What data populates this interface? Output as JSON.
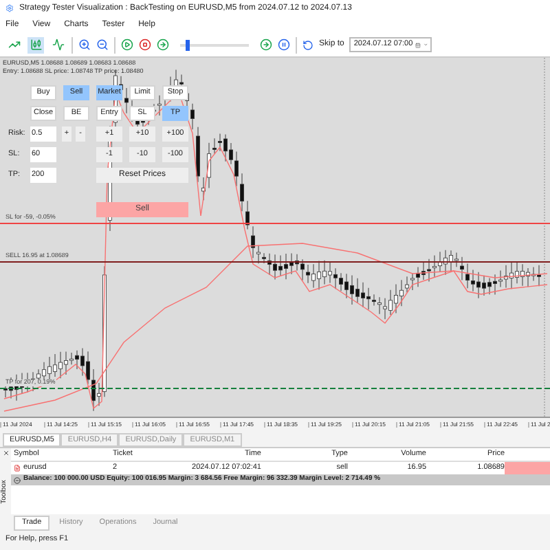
{
  "window": {
    "title": "Strategy Tester Visualization : BackTesting on EURUSD,M5 from 2024.07.12 to 2024.07.13"
  },
  "menu": [
    "File",
    "View",
    "Charts",
    "Tester",
    "Help"
  ],
  "toolbar": {
    "chart_modes": [
      {
        "kind": "bars",
        "selected": false
      },
      {
        "kind": "candles",
        "selected": true
      },
      {
        "kind": "line",
        "selected": false
      }
    ],
    "speed": {
      "level": 0.08
    },
    "skip_label": "Skip to",
    "skip_date": "2024.07.12 07:00"
  },
  "chart": {
    "info_lines": [
      "EURUSD,M5  1.08688 1.08689 1.08683 1.08688",
      "Entry: 1.08688  SL price: 1.08748  TP price: 1.08480"
    ],
    "levels": [
      {
        "kind": "sl",
        "label": "SL for -59, -0.05%"
      },
      {
        "kind": "entry",
        "label": "SELL 16.95 at 1.08689"
      },
      {
        "kind": "tp",
        "label": "TP for 207, 0.19%"
      }
    ],
    "panel": {
      "rows": [
        [
          {
            "label": "Buy",
            "selected": false
          },
          {
            "label": "Sell",
            "selected": true
          },
          {
            "label": "Market",
            "selected": true
          },
          {
            "label": "Limit",
            "selected": false
          },
          {
            "label": "Stop",
            "selected": false
          }
        ],
        [
          {
            "label": "Close",
            "selected": false
          },
          {
            "label": "BE",
            "selected": false
          },
          {
            "label": "Entry",
            "selected": false
          },
          {
            "label": "SL",
            "selected": false
          },
          {
            "label": "TP",
            "selected": true
          }
        ]
      ],
      "fields": [
        {
          "label": "Risk:",
          "value": "0.5",
          "small_buttons": [
            "+",
            "-"
          ],
          "steps": [
            "+1",
            "+10",
            "+100"
          ]
        },
        {
          "label": "SL:",
          "value": "60",
          "steps": [
            "-1",
            "-10",
            "-100"
          ]
        },
        {
          "label": "TP:",
          "value": "200"
        }
      ],
      "reset": "Reset Prices",
      "action": "Sell"
    },
    "time_labels": [
      "11 Jul 2024",
      "11 Jul 14:25",
      "11 Jul 15:15",
      "11 Jul 16:05",
      "11 Jul 16:55",
      "11 Jul 17:45",
      "11 Jul 18:35",
      "11 Jul 19:25",
      "11 Jul 20:15",
      "11 Jul 21:05",
      "11 Jul 21:55",
      "11 Jul 22:45",
      "11 Jul 2"
    ]
  },
  "chart_tabs": [
    {
      "label": "EURUSD,M5",
      "selected": true
    },
    {
      "label": "EURUSD,H4",
      "selected": false
    },
    {
      "label": "EURUSD,Daily",
      "selected": false
    },
    {
      "label": "EURUSD,M1",
      "selected": false
    }
  ],
  "toolbox": {
    "side_label": "Toolbox",
    "columns": [
      "Symbol",
      "Ticket",
      "Time",
      "Type",
      "Volume",
      "Price"
    ],
    "rows": [
      {
        "cells": [
          "eurusd",
          "2",
          "2024.07.12 07:02:41",
          "sell",
          "16.95",
          "1.08689"
        ]
      }
    ],
    "balance": "Balance: 100 000.00 USD  Equity: 100 016.95  Margin: 3 684.56  Free Margin: 96 332.39  Margin Level: 2 714.49 %",
    "tabs": [
      {
        "label": "Trade",
        "selected": true
      },
      {
        "label": "History",
        "selected": false
      },
      {
        "label": "Operations",
        "selected": false
      },
      {
        "label": "Journal",
        "selected": false
      }
    ]
  },
  "status_bar": "For Help, press F1"
}
